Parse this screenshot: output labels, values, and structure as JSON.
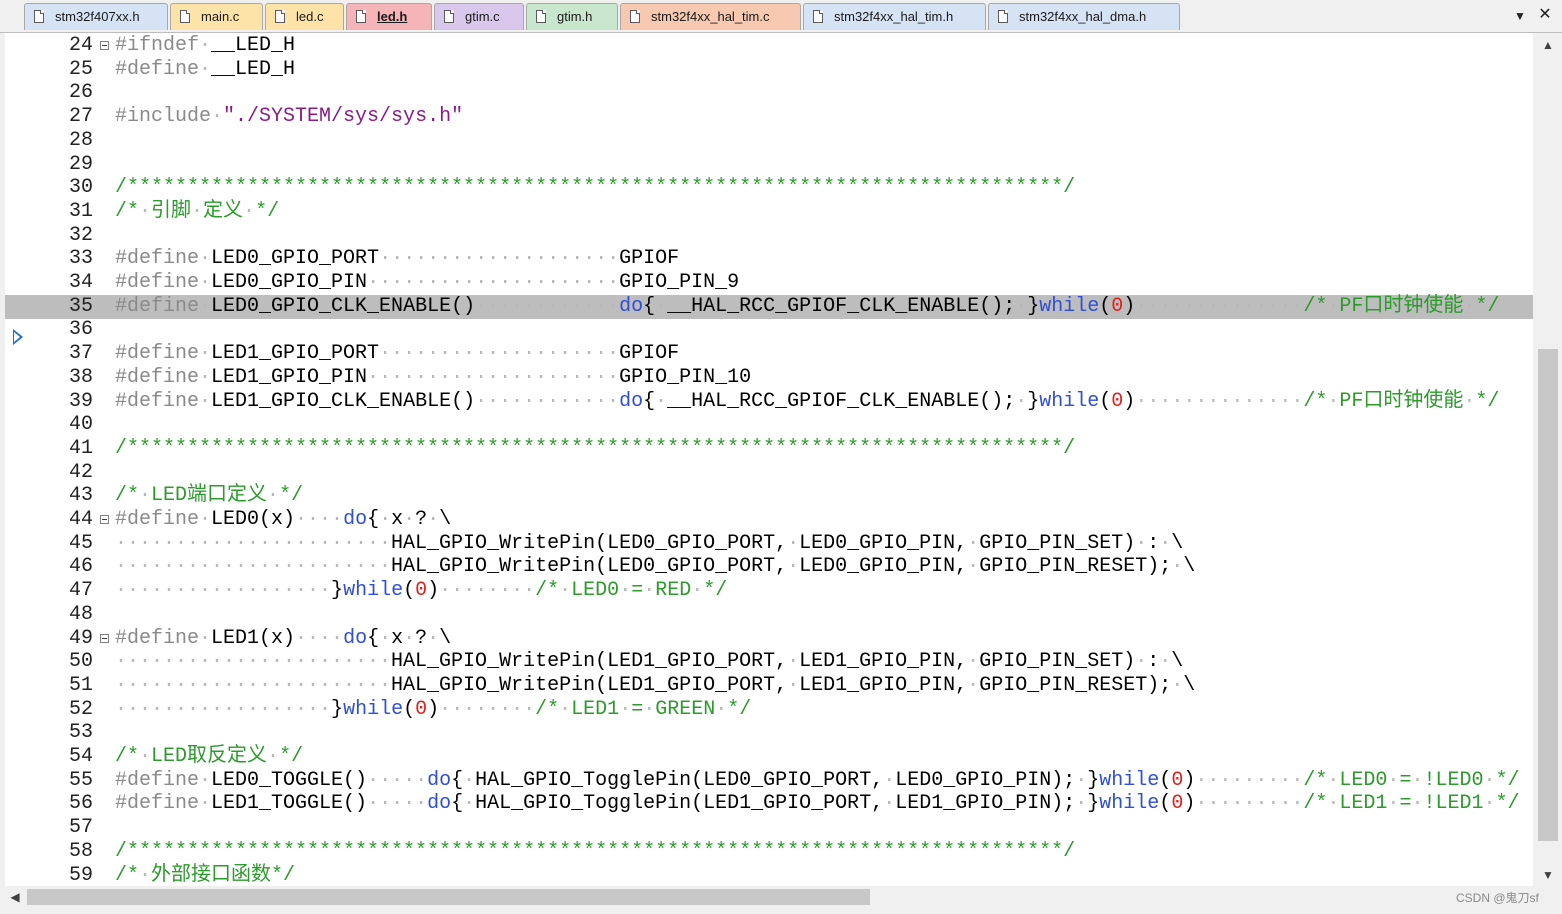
{
  "tabs": [
    {
      "label": "stm32f407xx.h",
      "color": "#d6e3f5",
      "active": false
    },
    {
      "label": "main.c",
      "color": "#fde3a7",
      "active": false
    },
    {
      "label": "led.c",
      "color": "#fde3a7",
      "active": false
    },
    {
      "label": "led.h",
      "color": "#f4b4b8",
      "active": true
    },
    {
      "label": "gtim.c",
      "color": "#d9c8ec",
      "active": false
    },
    {
      "label": "gtim.h",
      "color": "#c9e7cc",
      "active": false
    },
    {
      "label": "stm32f4xx_hal_tim.c",
      "color": "#f7c9b0",
      "active": false
    },
    {
      "label": "stm32f4xx_hal_tim.h",
      "color": "#d6e3f5",
      "active": false
    },
    {
      "label": "stm32f4xx_hal_dma.h",
      "color": "#d6e3f5",
      "active": false
    }
  ],
  "tab_menu_icon": "▼",
  "close_icon": "✕",
  "highlighted_line": 35,
  "lines": [
    {
      "n": 24,
      "fold": true,
      "t": [
        [
          "pp",
          "#ifndef"
        ],
        [
          "ws",
          "·"
        ],
        [
          "id",
          "__LED_H"
        ]
      ]
    },
    {
      "n": 25,
      "t": [
        [
          "pp",
          "#define"
        ],
        [
          "ws",
          "·"
        ],
        [
          "id",
          "__LED_H"
        ]
      ]
    },
    {
      "n": 26,
      "t": []
    },
    {
      "n": 27,
      "t": [
        [
          "pp",
          "#include"
        ],
        [
          "ws",
          "·"
        ],
        [
          "str",
          "\"./SYSTEM/sys/sys.h\""
        ]
      ]
    },
    {
      "n": 28,
      "t": []
    },
    {
      "n": 29,
      "t": []
    },
    {
      "n": 30,
      "t": [
        [
          "cm",
          "/******************************************************************************/"
        ]
      ]
    },
    {
      "n": 31,
      "t": [
        [
          "cm",
          "/*"
        ],
        [
          "ws",
          "·"
        ],
        [
          "cm",
          "引脚"
        ],
        [
          "ws",
          "·"
        ],
        [
          "cm",
          "定义"
        ],
        [
          "ws",
          "·"
        ],
        [
          "cm",
          "*/"
        ]
      ]
    },
    {
      "n": 32,
      "t": []
    },
    {
      "n": 33,
      "t": [
        [
          "pp",
          "#define"
        ],
        [
          "ws",
          "·"
        ],
        [
          "id",
          "LED0_GPIO_PORT"
        ],
        [
          "ws",
          "····················"
        ],
        [
          "id",
          "GPIOF"
        ]
      ]
    },
    {
      "n": 34,
      "t": [
        [
          "pp",
          "#define"
        ],
        [
          "ws",
          "·"
        ],
        [
          "id",
          "LED0_GPIO_PIN"
        ],
        [
          "ws",
          "·····················"
        ],
        [
          "id",
          "GPIO_PIN_9"
        ]
      ]
    },
    {
      "n": 35,
      "t": [
        [
          "pp",
          "#define"
        ],
        [
          "ws",
          "·"
        ],
        [
          "id",
          "LED0_GPIO_CLK_ENABLE()"
        ],
        [
          "ws",
          "············"
        ],
        [
          "kw",
          "do"
        ],
        [
          "sym",
          "{"
        ],
        [
          "ws",
          "·"
        ],
        [
          "id",
          "__HAL_RCC_GPIOF_CLK_ENABLE();"
        ],
        [
          "ws",
          "·"
        ],
        [
          "sym",
          "}"
        ],
        [
          "kw",
          "while"
        ],
        [
          "sym",
          "("
        ],
        [
          "nm",
          "0"
        ],
        [
          "sym",
          ")"
        ],
        [
          "ws",
          "··············"
        ],
        [
          "cm",
          "/*"
        ],
        [
          "ws",
          "·"
        ],
        [
          "cm",
          "PF口时钟使能"
        ],
        [
          "ws",
          "·"
        ],
        [
          "cm",
          "*/"
        ]
      ]
    },
    {
      "n": 36,
      "t": []
    },
    {
      "n": 37,
      "t": [
        [
          "pp",
          "#define"
        ],
        [
          "ws",
          "·"
        ],
        [
          "id",
          "LED1_GPIO_PORT"
        ],
        [
          "ws",
          "····················"
        ],
        [
          "id",
          "GPIOF"
        ]
      ]
    },
    {
      "n": 38,
      "t": [
        [
          "pp",
          "#define"
        ],
        [
          "ws",
          "·"
        ],
        [
          "id",
          "LED1_GPIO_PIN"
        ],
        [
          "ws",
          "·····················"
        ],
        [
          "id",
          "GPIO_PIN_10"
        ]
      ]
    },
    {
      "n": 39,
      "t": [
        [
          "pp",
          "#define"
        ],
        [
          "ws",
          "·"
        ],
        [
          "id",
          "LED1_GPIO_CLK_ENABLE()"
        ],
        [
          "ws",
          "············"
        ],
        [
          "kw",
          "do"
        ],
        [
          "sym",
          "{"
        ],
        [
          "ws",
          "·"
        ],
        [
          "id",
          "__HAL_RCC_GPIOF_CLK_ENABLE();"
        ],
        [
          "ws",
          "·"
        ],
        [
          "sym",
          "}"
        ],
        [
          "kw",
          "while"
        ],
        [
          "sym",
          "("
        ],
        [
          "nm",
          "0"
        ],
        [
          "sym",
          ")"
        ],
        [
          "ws",
          "··············"
        ],
        [
          "cm",
          "/*"
        ],
        [
          "ws",
          "·"
        ],
        [
          "cm",
          "PF口时钟使能"
        ],
        [
          "ws",
          "·"
        ],
        [
          "cm",
          "*/"
        ]
      ]
    },
    {
      "n": 40,
      "t": []
    },
    {
      "n": 41,
      "t": [
        [
          "cm",
          "/******************************************************************************/"
        ]
      ]
    },
    {
      "n": 42,
      "t": []
    },
    {
      "n": 43,
      "t": [
        [
          "cm",
          "/*"
        ],
        [
          "ws",
          "·"
        ],
        [
          "cm",
          "LED端口定义"
        ],
        [
          "ws",
          "·"
        ],
        [
          "cm",
          "*/"
        ]
      ]
    },
    {
      "n": 44,
      "fold": true,
      "t": [
        [
          "pp",
          "#define"
        ],
        [
          "ws",
          "·"
        ],
        [
          "id",
          "LED0(x)"
        ],
        [
          "ws",
          "····"
        ],
        [
          "kw",
          "do"
        ],
        [
          "sym",
          "{"
        ],
        [
          "ws",
          "·"
        ],
        [
          "id",
          "x"
        ],
        [
          "ws",
          "·"
        ],
        [
          "sym",
          "?"
        ],
        [
          "ws",
          "·"
        ],
        [
          "sym",
          "\\"
        ]
      ]
    },
    {
      "n": 45,
      "t": [
        [
          "ws",
          "·······················"
        ],
        [
          "id",
          "HAL_GPIO_WritePin(LED0_GPIO_PORT,"
        ],
        [
          "ws",
          "·"
        ],
        [
          "id",
          "LED0_GPIO_PIN,"
        ],
        [
          "ws",
          "·"
        ],
        [
          "id",
          "GPIO_PIN_SET)"
        ],
        [
          "ws",
          "·"
        ],
        [
          "sym",
          ":"
        ],
        [
          "ws",
          "·"
        ],
        [
          "sym",
          "\\"
        ]
      ]
    },
    {
      "n": 46,
      "t": [
        [
          "ws",
          "·······················"
        ],
        [
          "id",
          "HAL_GPIO_WritePin(LED0_GPIO_PORT,"
        ],
        [
          "ws",
          "·"
        ],
        [
          "id",
          "LED0_GPIO_PIN,"
        ],
        [
          "ws",
          "·"
        ],
        [
          "id",
          "GPIO_PIN_RESET);"
        ],
        [
          "ws",
          "·"
        ],
        [
          "sym",
          "\\"
        ]
      ]
    },
    {
      "n": 47,
      "t": [
        [
          "ws",
          "··················"
        ],
        [
          "sym",
          "}"
        ],
        [
          "kw",
          "while"
        ],
        [
          "sym",
          "("
        ],
        [
          "nm",
          "0"
        ],
        [
          "sym",
          ")"
        ],
        [
          "ws",
          "········"
        ],
        [
          "cm",
          "/*"
        ],
        [
          "ws",
          "·"
        ],
        [
          "cm",
          "LED0"
        ],
        [
          "ws",
          "·"
        ],
        [
          "cm",
          "="
        ],
        [
          "ws",
          "·"
        ],
        [
          "cm",
          "RED"
        ],
        [
          "ws",
          "·"
        ],
        [
          "cm",
          "*/"
        ]
      ]
    },
    {
      "n": 48,
      "t": []
    },
    {
      "n": 49,
      "fold": true,
      "t": [
        [
          "pp",
          "#define"
        ],
        [
          "ws",
          "·"
        ],
        [
          "id",
          "LED1(x)"
        ],
        [
          "ws",
          "····"
        ],
        [
          "kw",
          "do"
        ],
        [
          "sym",
          "{"
        ],
        [
          "ws",
          "·"
        ],
        [
          "id",
          "x"
        ],
        [
          "ws",
          "·"
        ],
        [
          "sym",
          "?"
        ],
        [
          "ws",
          "·"
        ],
        [
          "sym",
          "\\"
        ]
      ]
    },
    {
      "n": 50,
      "t": [
        [
          "ws",
          "·······················"
        ],
        [
          "id",
          "HAL_GPIO_WritePin(LED1_GPIO_PORT,"
        ],
        [
          "ws",
          "·"
        ],
        [
          "id",
          "LED1_GPIO_PIN,"
        ],
        [
          "ws",
          "·"
        ],
        [
          "id",
          "GPIO_PIN_SET)"
        ],
        [
          "ws",
          "·"
        ],
        [
          "sym",
          ":"
        ],
        [
          "ws",
          "·"
        ],
        [
          "sym",
          "\\"
        ]
      ]
    },
    {
      "n": 51,
      "t": [
        [
          "ws",
          "·······················"
        ],
        [
          "id",
          "HAL_GPIO_WritePin(LED1_GPIO_PORT,"
        ],
        [
          "ws",
          "·"
        ],
        [
          "id",
          "LED1_GPIO_PIN,"
        ],
        [
          "ws",
          "·"
        ],
        [
          "id",
          "GPIO_PIN_RESET);"
        ],
        [
          "ws",
          "·"
        ],
        [
          "sym",
          "\\"
        ]
      ]
    },
    {
      "n": 52,
      "t": [
        [
          "ws",
          "··················"
        ],
        [
          "sym",
          "}"
        ],
        [
          "kw",
          "while"
        ],
        [
          "sym",
          "("
        ],
        [
          "nm",
          "0"
        ],
        [
          "sym",
          ")"
        ],
        [
          "ws",
          "········"
        ],
        [
          "cm",
          "/*"
        ],
        [
          "ws",
          "·"
        ],
        [
          "cm",
          "LED1"
        ],
        [
          "ws",
          "·"
        ],
        [
          "cm",
          "="
        ],
        [
          "ws",
          "·"
        ],
        [
          "cm",
          "GREEN"
        ],
        [
          "ws",
          "·"
        ],
        [
          "cm",
          "*/"
        ]
      ]
    },
    {
      "n": 53,
      "t": []
    },
    {
      "n": 54,
      "t": [
        [
          "cm",
          "/*"
        ],
        [
          "ws",
          "·"
        ],
        [
          "cm",
          "LED取反定义"
        ],
        [
          "ws",
          "·"
        ],
        [
          "cm",
          "*/"
        ]
      ]
    },
    {
      "n": 55,
      "t": [
        [
          "pp",
          "#define"
        ],
        [
          "ws",
          "·"
        ],
        [
          "id",
          "LED0_TOGGLE()"
        ],
        [
          "ws",
          "·····"
        ],
        [
          "kw",
          "do"
        ],
        [
          "sym",
          "{"
        ],
        [
          "ws",
          "·"
        ],
        [
          "id",
          "HAL_GPIO_TogglePin(LED0_GPIO_PORT,"
        ],
        [
          "ws",
          "·"
        ],
        [
          "id",
          "LED0_GPIO_PIN);"
        ],
        [
          "ws",
          "·"
        ],
        [
          "sym",
          "}"
        ],
        [
          "kw",
          "while"
        ],
        [
          "sym",
          "("
        ],
        [
          "nm",
          "0"
        ],
        [
          "sym",
          ")"
        ],
        [
          "ws",
          "·········"
        ],
        [
          "cm",
          "/*"
        ],
        [
          "ws",
          "·"
        ],
        [
          "cm",
          "LED0"
        ],
        [
          "ws",
          "·"
        ],
        [
          "cm",
          "="
        ],
        [
          "ws",
          "·"
        ],
        [
          "cm",
          "!LED0"
        ],
        [
          "ws",
          "·"
        ],
        [
          "cm",
          "*/"
        ]
      ]
    },
    {
      "n": 56,
      "t": [
        [
          "pp",
          "#define"
        ],
        [
          "ws",
          "·"
        ],
        [
          "id",
          "LED1_TOGGLE()"
        ],
        [
          "ws",
          "·····"
        ],
        [
          "kw",
          "do"
        ],
        [
          "sym",
          "{"
        ],
        [
          "ws",
          "·"
        ],
        [
          "id",
          "HAL_GPIO_TogglePin(LED1_GPIO_PORT,"
        ],
        [
          "ws",
          "·"
        ],
        [
          "id",
          "LED1_GPIO_PIN);"
        ],
        [
          "ws",
          "·"
        ],
        [
          "sym",
          "}"
        ],
        [
          "kw",
          "while"
        ],
        [
          "sym",
          "("
        ],
        [
          "nm",
          "0"
        ],
        [
          "sym",
          ")"
        ],
        [
          "ws",
          "·········"
        ],
        [
          "cm",
          "/*"
        ],
        [
          "ws",
          "·"
        ],
        [
          "cm",
          "LED1"
        ],
        [
          "ws",
          "·"
        ],
        [
          "cm",
          "="
        ],
        [
          "ws",
          "·"
        ],
        [
          "cm",
          "!LED1"
        ],
        [
          "ws",
          "·"
        ],
        [
          "cm",
          "*/"
        ]
      ]
    },
    {
      "n": 57,
      "t": []
    },
    {
      "n": 58,
      "t": [
        [
          "cm",
          "/******************************************************************************/"
        ]
      ]
    },
    {
      "n": 59,
      "t": [
        [
          "cm",
          "/*"
        ],
        [
          "ws",
          "·"
        ],
        [
          "cm",
          "外部接口函数*/"
        ]
      ]
    }
  ],
  "scroll_up_icon": "▲",
  "scroll_down_icon": "▼",
  "scroll_left_icon": "◀",
  "watermark": "CSDN @鬼刀sf"
}
